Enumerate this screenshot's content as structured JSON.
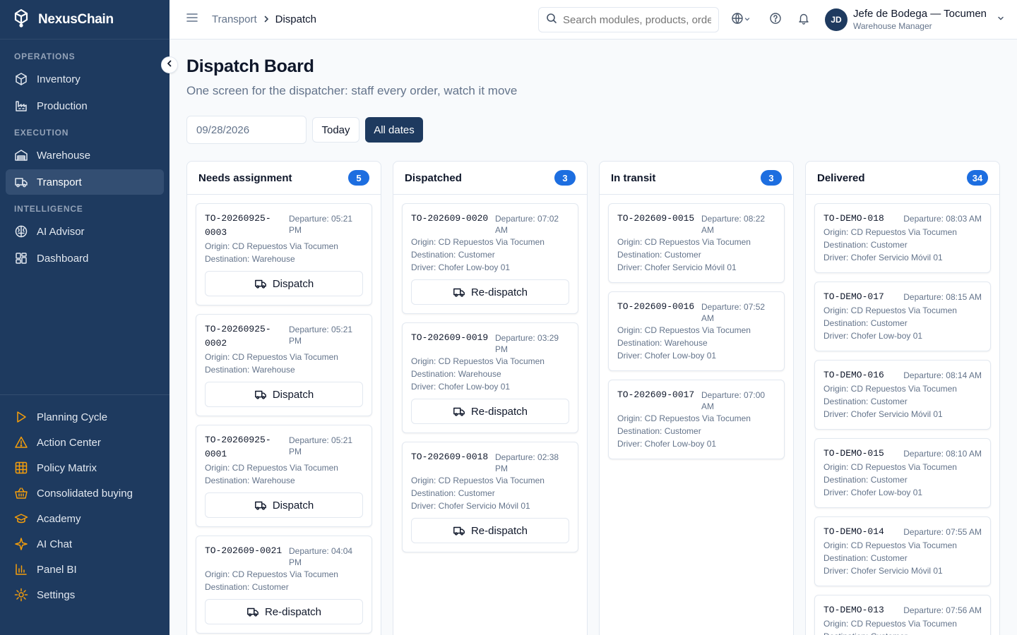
{
  "brand": {
    "name": "NexusChain"
  },
  "sidebar": {
    "sections": [
      {
        "label": "OPERATIONS",
        "items": [
          {
            "label": "Inventory",
            "icon": "box-icon"
          },
          {
            "label": "Production",
            "icon": "factory-icon"
          }
        ]
      },
      {
        "label": "EXECUTION",
        "items": [
          {
            "label": "Warehouse",
            "icon": "warehouse-icon"
          },
          {
            "label": "Transport",
            "icon": "truck-icon",
            "active": true
          }
        ]
      },
      {
        "label": "INTELLIGENCE",
        "items": [
          {
            "label": "AI Advisor",
            "icon": "brain-icon"
          },
          {
            "label": "Dashboard",
            "icon": "dashboard-icon"
          }
        ]
      }
    ],
    "bottom_items": [
      {
        "label": "Planning Cycle",
        "icon": "play-icon"
      },
      {
        "label": "Action Center",
        "icon": "alert-icon"
      },
      {
        "label": "Policy Matrix",
        "icon": "grid-icon"
      },
      {
        "label": "Consolidated buying",
        "icon": "basket-icon"
      },
      {
        "label": "Academy",
        "icon": "graduation-cap-icon"
      },
      {
        "label": "AI Chat",
        "icon": "sparkles-icon"
      },
      {
        "label": "Panel BI",
        "icon": "bar-chart-icon"
      },
      {
        "label": "Settings",
        "icon": "gear-icon"
      }
    ],
    "accent_color": "#f59e0b"
  },
  "header": {
    "breadcrumb_parent": "Transport",
    "breadcrumb_current": "Dispatch",
    "search_placeholder": "Search modules, products, orders...",
    "user": {
      "initials": "JD",
      "name": "Jefe de Bodega — Tocumen",
      "role": "Warehouse Manager"
    }
  },
  "page": {
    "title": "Dispatch Board",
    "subtitle": "One screen for the dispatcher: staff every order, watch it move",
    "date_value": "09/28/2026",
    "today_label": "Today",
    "all_dates_label": "All dates"
  },
  "columns": [
    {
      "title": "Needs assignment",
      "count": "5",
      "cards": [
        {
          "id": "TO-20260925-0003",
          "departure": "Departure: 05:21 PM",
          "lines": [
            "Origin: CD Repuestos Via Tocumen",
            "Destination: Warehouse"
          ],
          "action": "Dispatch"
        },
        {
          "id": "TO-20260925-0002",
          "departure": "Departure: 05:21 PM",
          "lines": [
            "Origin: CD Repuestos Via Tocumen",
            "Destination: Warehouse"
          ],
          "action": "Dispatch"
        },
        {
          "id": "TO-20260925-0001",
          "departure": "Departure: 05:21 PM",
          "lines": [
            "Origin: CD Repuestos Via Tocumen",
            "Destination: Warehouse"
          ],
          "action": "Dispatch"
        },
        {
          "id": "TO-202609-0021",
          "departure": "Departure: 04:04 PM",
          "lines": [
            "Origin: CD Repuestos Via Tocumen",
            "Destination: Customer"
          ],
          "action": "Re-dispatch"
        }
      ]
    },
    {
      "title": "Dispatched",
      "count": "3",
      "cards": [
        {
          "id": "TO-202609-0020",
          "departure": "Departure: 07:02 AM",
          "lines": [
            "Origin: CD Repuestos Via Tocumen",
            "Destination: Customer",
            "Driver: Chofer Low-boy 01"
          ],
          "action": "Re-dispatch"
        },
        {
          "id": "TO-202609-0019",
          "departure": "Departure: 03:29 PM",
          "lines": [
            "Origin: CD Repuestos Via Tocumen",
            "Destination: Warehouse",
            "Driver: Chofer Low-boy 01"
          ],
          "action": "Re-dispatch"
        },
        {
          "id": "TO-202609-0018",
          "departure": "Departure: 02:38 PM",
          "lines": [
            "Origin: CD Repuestos Via Tocumen",
            "Destination: Customer",
            "Driver: Chofer Servicio Móvil 01"
          ],
          "action": "Re-dispatch"
        }
      ]
    },
    {
      "title": "In transit",
      "count": "3",
      "cards": [
        {
          "id": "TO-202609-0015",
          "departure": "Departure: 08:22 AM",
          "lines": [
            "Origin: CD Repuestos Via Tocumen",
            "Destination: Customer",
            "Driver: Chofer Servicio Móvil 01"
          ],
          "action": ""
        },
        {
          "id": "TO-202609-0016",
          "departure": "Departure: 07:52 AM",
          "lines": [
            "Origin: CD Repuestos Via Tocumen",
            "Destination: Warehouse",
            "Driver: Chofer Low-boy 01"
          ],
          "action": ""
        },
        {
          "id": "TO-202609-0017",
          "departure": "Departure: 07:00 AM",
          "lines": [
            "Origin: CD Repuestos Via Tocumen",
            "Destination: Customer",
            "Driver: Chofer Low-boy 01"
          ],
          "action": ""
        }
      ]
    },
    {
      "title": "Delivered",
      "count": "34",
      "cards": [
        {
          "id": "TO-DEMO-018",
          "departure": "Departure: 08:03 AM",
          "lines": [
            "Origin: CD Repuestos Via Tocumen",
            "Destination: Customer",
            "Driver: Chofer Servicio Móvil 01"
          ],
          "action": ""
        },
        {
          "id": "TO-DEMO-017",
          "departure": "Departure: 08:15 AM",
          "lines": [
            "Origin: CD Repuestos Via Tocumen",
            "Destination: Customer",
            "Driver: Chofer Low-boy 01"
          ],
          "action": ""
        },
        {
          "id": "TO-DEMO-016",
          "departure": "Departure: 08:14 AM",
          "lines": [
            "Origin: CD Repuestos Via Tocumen",
            "Destination: Customer",
            "Driver: Chofer Servicio Móvil 01"
          ],
          "action": ""
        },
        {
          "id": "TO-DEMO-015",
          "departure": "Departure: 08:10 AM",
          "lines": [
            "Origin: CD Repuestos Via Tocumen",
            "Destination: Customer",
            "Driver: Chofer Low-boy 01"
          ],
          "action": ""
        },
        {
          "id": "TO-DEMO-014",
          "departure": "Departure: 07:55 AM",
          "lines": [
            "Origin: CD Repuestos Via Tocumen",
            "Destination: Customer",
            "Driver: Chofer Servicio Móvil 01"
          ],
          "action": ""
        },
        {
          "id": "TO-DEMO-013",
          "departure": "Departure: 07:56 AM",
          "lines": [
            "Origin: CD Repuestos Via Tocumen",
            "Destination: Customer"
          ],
          "action": ""
        }
      ]
    }
  ]
}
